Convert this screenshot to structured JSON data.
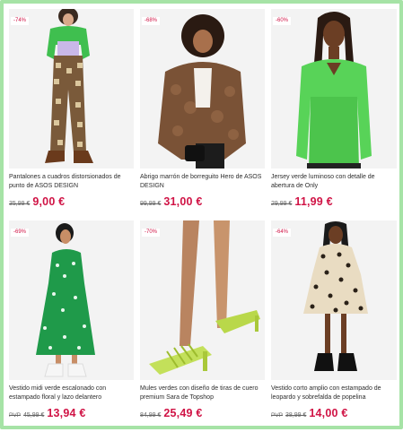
{
  "products": [
    {
      "discount": "-74%",
      "title": "Pantalones a cuadros distorsionados de punto de ASOS DESIGN",
      "rrp_prefix": "",
      "was_price": "35,99 €",
      "now_price": "9,00 €",
      "image": "model-checkered-trousers-green-cardigan"
    },
    {
      "discount": "-68%",
      "title": "Abrigo marrón de borreguito Hero de ASOS DESIGN",
      "rrp_prefix": "",
      "was_price": "99,99 €",
      "now_price": "31,00 €",
      "image": "model-brown-teddy-coat"
    },
    {
      "discount": "-60%",
      "title": "Jersey verde luminoso con detalle de abertura de Only",
      "rrp_prefix": "",
      "was_price": "29,99 €",
      "now_price": "11,99 €",
      "image": "model-green-knit-jumper"
    },
    {
      "discount": "-69%",
      "title": "Vestido midi verde escalonado con estampado floral y lazo delantero",
      "rrp_prefix": "PVP",
      "was_price": "45,99 €",
      "now_price": "13,94 €",
      "image": "model-green-floral-midi-dress"
    },
    {
      "discount": "-70%",
      "title": "Mules verdes con diseño de tiras de cuero premium Sara de Topshop",
      "rrp_prefix": "",
      "was_price": "84,99 €",
      "now_price": "25,49 €",
      "image": "green-strappy-heeled-mules"
    },
    {
      "discount": "-64%",
      "title": "Vestido corto amplio con estampado de leopardo y sobrefalda de popelina",
      "rrp_prefix": "PVP",
      "was_price": "38,99 €",
      "now_price": "14,00 €",
      "image": "model-leopard-print-smock-dress"
    }
  ],
  "colors": {
    "accent": "#d01345",
    "frame": "#a6e3a6",
    "text": "#2d2d2d"
  }
}
